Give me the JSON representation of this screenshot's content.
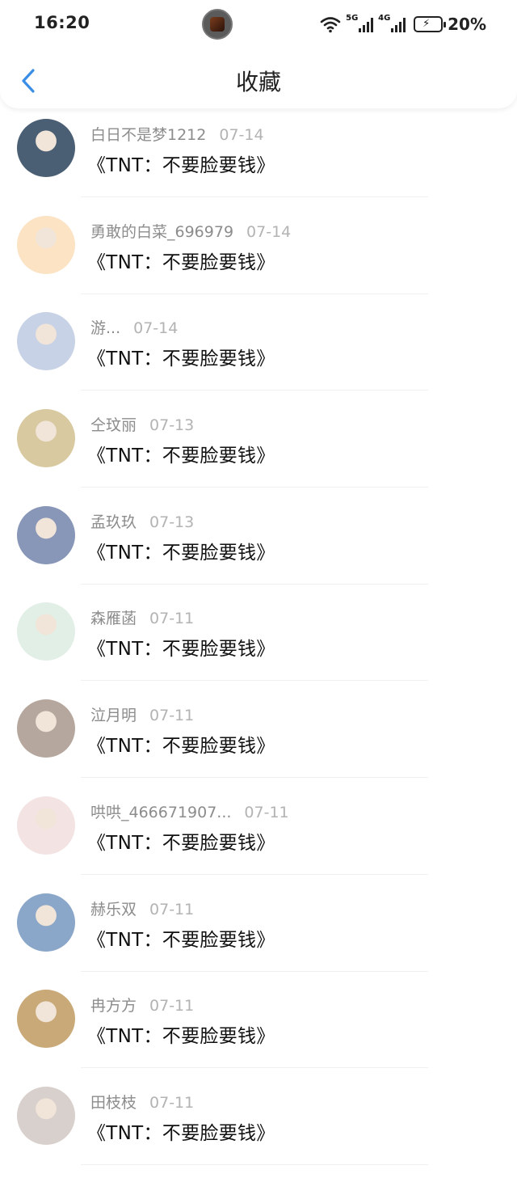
{
  "status_bar": {
    "time": "16:20",
    "network_5g": "5G",
    "network_4g": "4G",
    "battery_percent": "20%",
    "icons": [
      "wifi-icon",
      "signal-5g-icon",
      "signal-4g-icon",
      "battery-charging-icon"
    ]
  },
  "nav": {
    "title": "收藏",
    "back_icon": "chevron-left-icon",
    "accent_color": "#3a8ee6"
  },
  "favorites": [
    {
      "user": "白日不是梦1212",
      "date": "07-14",
      "title": "《TNT：不要脸要钱》",
      "avatar_color": "#4a5f73"
    },
    {
      "user": "勇敢的白菜_696979",
      "date": "07-14",
      "title": "《TNT：不要脸要钱》",
      "avatar_color": "#fbe3c4"
    },
    {
      "user": "游...",
      "date": "07-14",
      "title": "《TNT：不要脸要钱》",
      "avatar_color": "#c7d2e6"
    },
    {
      "user": "仝玟丽",
      "date": "07-13",
      "title": "《TNT：不要脸要钱》",
      "avatar_color": "#d8c9a0"
    },
    {
      "user": "孟玖玖",
      "date": "07-13",
      "title": "《TNT：不要脸要钱》",
      "avatar_color": "#8896b8"
    },
    {
      "user": "森雁菡",
      "date": "07-11",
      "title": "《TNT：不要脸要钱》",
      "avatar_color": "#e2efe6"
    },
    {
      "user": "泣月明",
      "date": "07-11",
      "title": "《TNT：不要脸要钱》",
      "avatar_color": "#b5a79d"
    },
    {
      "user": "哄哄_466671907...",
      "date": "07-11",
      "title": "《TNT：不要脸要钱》",
      "avatar_color": "#f3e3e3"
    },
    {
      "user": "赫乐双",
      "date": "07-11",
      "title": "《TNT：不要脸要钱》",
      "avatar_color": "#8aa7c9"
    },
    {
      "user": "冉方方",
      "date": "07-11",
      "title": "《TNT：不要脸要钱》",
      "avatar_color": "#c9a978"
    },
    {
      "user": "田枝枝",
      "date": "07-11",
      "title": "《TNT：不要脸要钱》",
      "avatar_color": "#d8d0cc"
    }
  ]
}
